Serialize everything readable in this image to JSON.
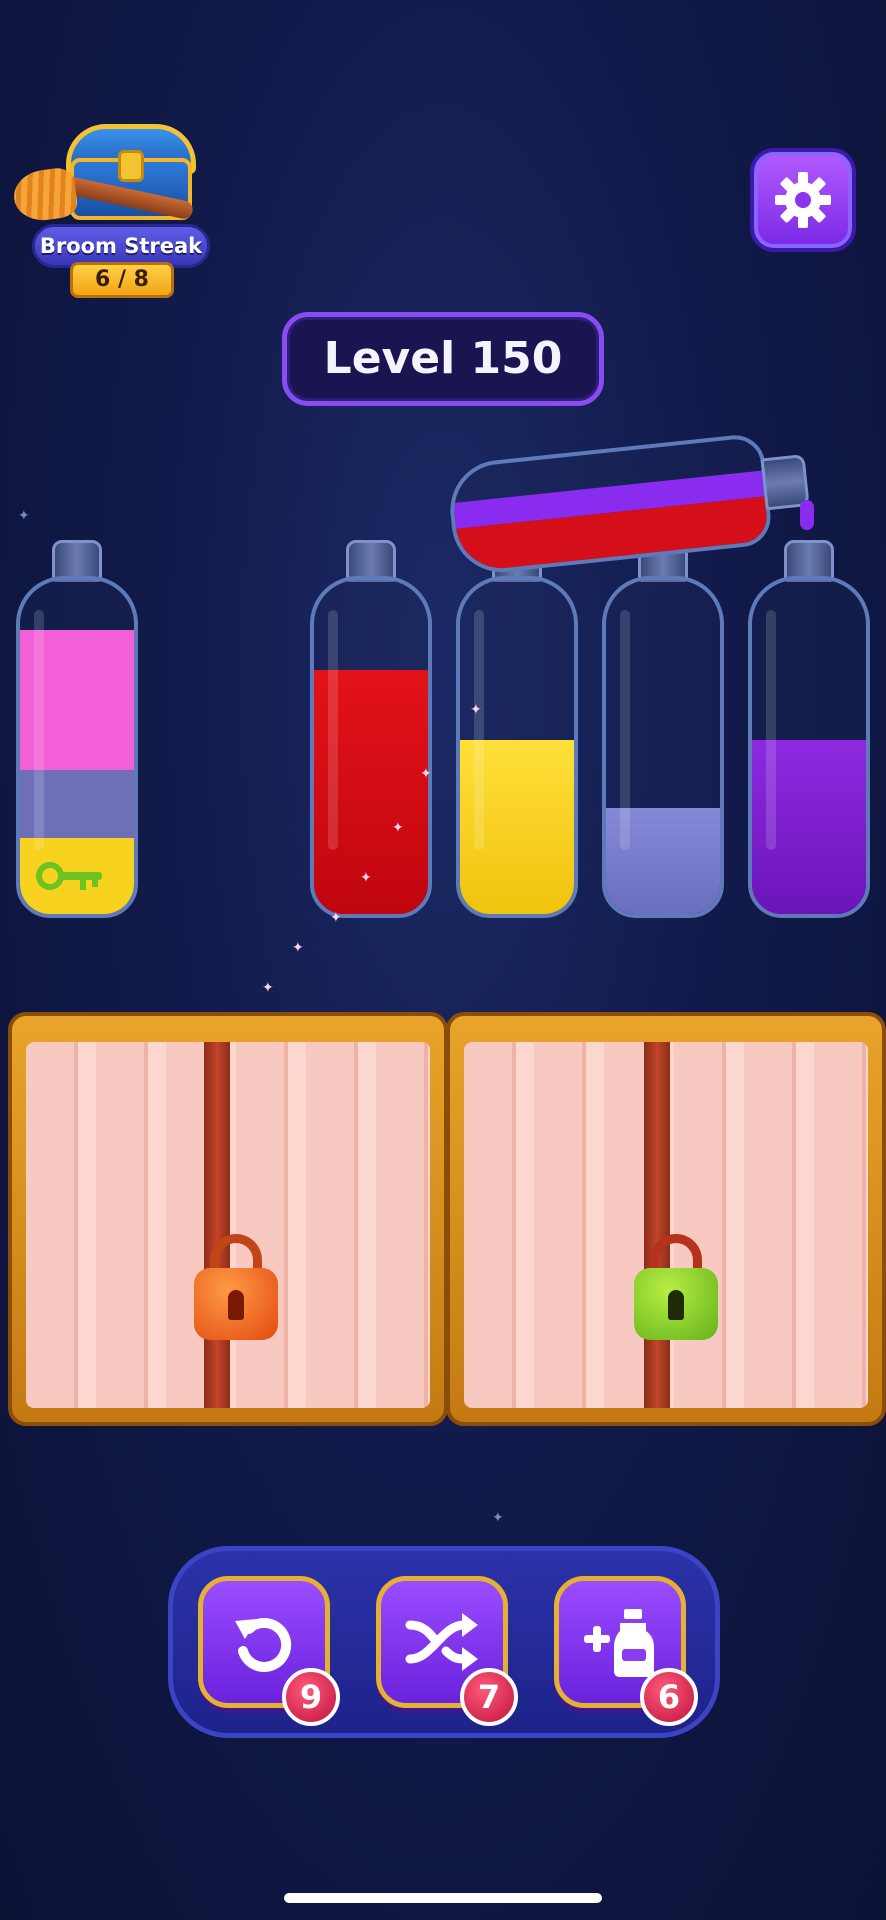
{
  "streak": {
    "label": "Broom Streak",
    "count": "6 / 8"
  },
  "settings": {
    "icon": "gear-icon"
  },
  "level": {
    "label": "Level 150"
  },
  "bottles": [
    {
      "id": 1,
      "layers": [
        "#f25fd7",
        "#6f6fb8",
        "#f7d21e"
      ],
      "has_key": true,
      "key_color": "#6ec41e"
    },
    {
      "id": 2,
      "layers": [
        "#d80a14"
      ]
    },
    {
      "id": 3,
      "layers": [
        "#f7d21e"
      ]
    },
    {
      "id": 4,
      "layers": [
        "#7275c4"
      ]
    },
    {
      "id": 5,
      "layers": [
        "#7a1cd0"
      ]
    }
  ],
  "pouring_bottle": {
    "layers": [
      "#d40f1a",
      "#8a2cf0"
    ]
  },
  "locked_doors": [
    {
      "lock_color": "#f0641e",
      "lock_name": "orange-padlock"
    },
    {
      "lock_color": "#7ec81e",
      "lock_name": "green-padlock"
    }
  ],
  "tools": [
    {
      "name": "undo",
      "icon": "undo-icon",
      "count": "9"
    },
    {
      "name": "shuffle",
      "icon": "shuffle-icon",
      "count": "7"
    },
    {
      "name": "add-bottle",
      "icon": "add-bottle-icon",
      "count": "6"
    }
  ]
}
